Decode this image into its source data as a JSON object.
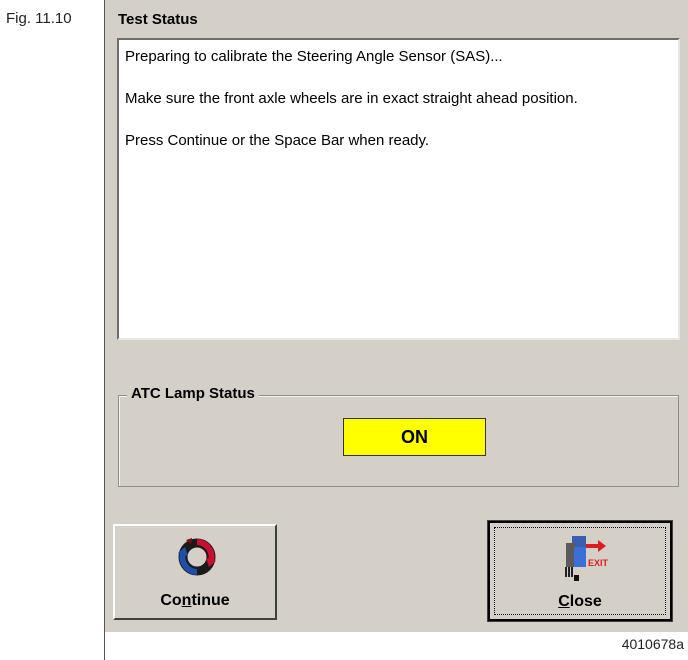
{
  "figure": {
    "label": "Fig. 11.10",
    "image_id": "4010678a"
  },
  "window": {
    "title": "Test Status"
  },
  "status_text": {
    "line1": "Preparing to calibrate the Steering Angle Sensor (SAS)...",
    "line2": "Make sure the front axle wheels are in exact straight ahead position.",
    "line3": "Press Continue or the Space Bar when ready."
  },
  "atc_group": {
    "legend": "ATC Lamp Status",
    "lamp_value": "ON",
    "lamp_color": "#ffff00"
  },
  "buttons": {
    "continue": {
      "label_pre": "Co",
      "label_accel": "n",
      "label_post": "tinue",
      "icon": "refresh-icon"
    },
    "close": {
      "label_accel": "C",
      "label_post": "lose",
      "icon": "exit-icon",
      "icon_text": "EXIT"
    }
  }
}
